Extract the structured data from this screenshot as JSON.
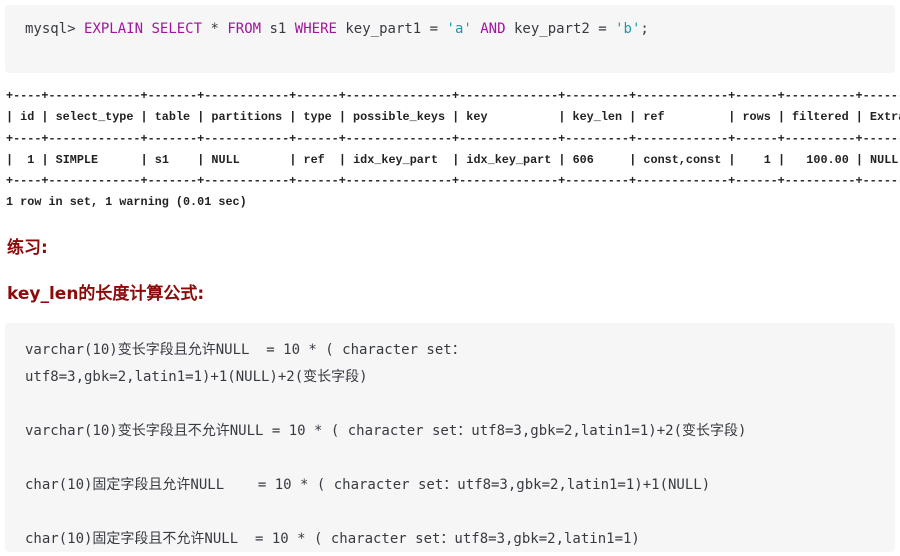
{
  "sql": {
    "prompt": "mysql> ",
    "tokens": [
      {
        "t": "EXPLAIN",
        "k": "kw"
      },
      {
        "t": " "
      },
      {
        "t": "SELECT",
        "k": "kw"
      },
      {
        "t": " * "
      },
      {
        "t": "FROM",
        "k": "kw"
      },
      {
        "t": " s1 "
      },
      {
        "t": "WHERE",
        "k": "kw"
      },
      {
        "t": " key_part1 = "
      },
      {
        "t": "'a'",
        "k": "str"
      },
      {
        "t": " "
      },
      {
        "t": "AND",
        "k": "kw"
      },
      {
        "t": " key_part2 = "
      },
      {
        "t": "'b'",
        "k": "str"
      },
      {
        "t": ";"
      }
    ]
  },
  "result_table": {
    "columns": [
      "id",
      "select_type",
      "table",
      "partitions",
      "type",
      "possible_keys",
      "key",
      "key_len",
      "ref",
      "rows",
      "filtered",
      "Extra"
    ],
    "rows": [
      [
        "1",
        "SIMPLE",
        "s1",
        "NULL",
        "ref",
        "idx_key_part",
        "idx_key_part",
        "606",
        "const,const",
        "1",
        "100.00",
        "NULL"
      ]
    ],
    "footer": "1 row in set, 1 warning (0.01 sec)"
  },
  "headings": {
    "practice": "练习:",
    "formula_title": "key_len的长度计算公式:"
  },
  "formula_lines": [
    "varchar(10)变长字段且允许NULL  = 10 * ( character set：",
    "utf8=3,gbk=2,latin1=1)+1(NULL)+2(变长字段)",
    "",
    "varchar(10)变长字段且不允许NULL = 10 * ( character set：utf8=3,gbk=2,latin1=1)+2(变长字段)",
    "",
    "char(10)固定字段且允许NULL    = 10 * ( character set：utf8=3,gbk=2,latin1=1)+1(NULL)",
    "",
    "char(10)固定字段且不允许NULL  = 10 * ( character set：utf8=3,gbk=2,latin1=1)"
  ],
  "colors": {
    "keyword": "#a0149f",
    "string": "#1a9aa6",
    "heading": "#8b0a0a",
    "code_bg": "#f6f6f7"
  }
}
